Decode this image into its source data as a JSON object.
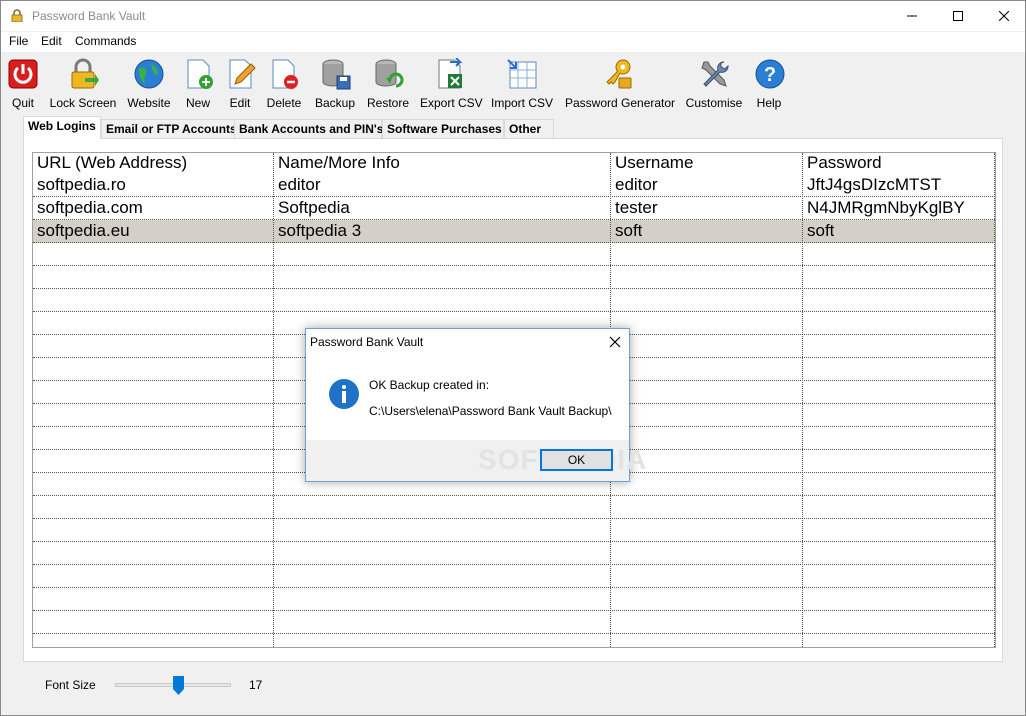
{
  "window": {
    "title": "Password Bank Vault"
  },
  "menu": {
    "file": "File",
    "edit": "Edit",
    "commands": "Commands"
  },
  "toolbar": {
    "quit": "Quit",
    "lock_screen": "Lock Screen",
    "website": "Website",
    "new": "New",
    "edit": "Edit",
    "delete": "Delete",
    "backup": "Backup",
    "restore": "Restore",
    "export_csv": "Export CSV",
    "import_csv": "Import CSV",
    "password_generator": "Password Generator",
    "customise": "Customise",
    "help": "Help"
  },
  "tabs": [
    "Web Logins",
    "Email or FTP Accounts",
    "Bank Accounts and PIN's",
    "Software Purchases",
    "Other"
  ],
  "table": {
    "headers": [
      "URL (Web Address)",
      "Name/More Info",
      "Username",
      "Password"
    ],
    "rows": [
      [
        "softpedia.ro",
        "editor",
        "editor",
        "JftJ4gsDIzcMTST"
      ],
      [
        "softpedia.com",
        "Softpedia",
        "tester",
        "N4JMRgmNbyKglBY"
      ],
      [
        "softpedia.eu",
        "softpedia 3",
        "soft",
        "soft"
      ]
    ]
  },
  "font_size": {
    "label": "Font Size",
    "value": "17",
    "slider_fraction": 0.55
  },
  "dialog": {
    "title": "Password Bank Vault",
    "message_line1": "OK Backup created in:",
    "message_line2": "C:\\Users\\elena\\Password Bank Vault Backup\\",
    "ok_label": "OK",
    "watermark": "SOFTPEDIA"
  },
  "colors": {
    "accent": "#0078d7",
    "selected_row": "#d4d0c8",
    "info_icon": "#1e72c8"
  }
}
